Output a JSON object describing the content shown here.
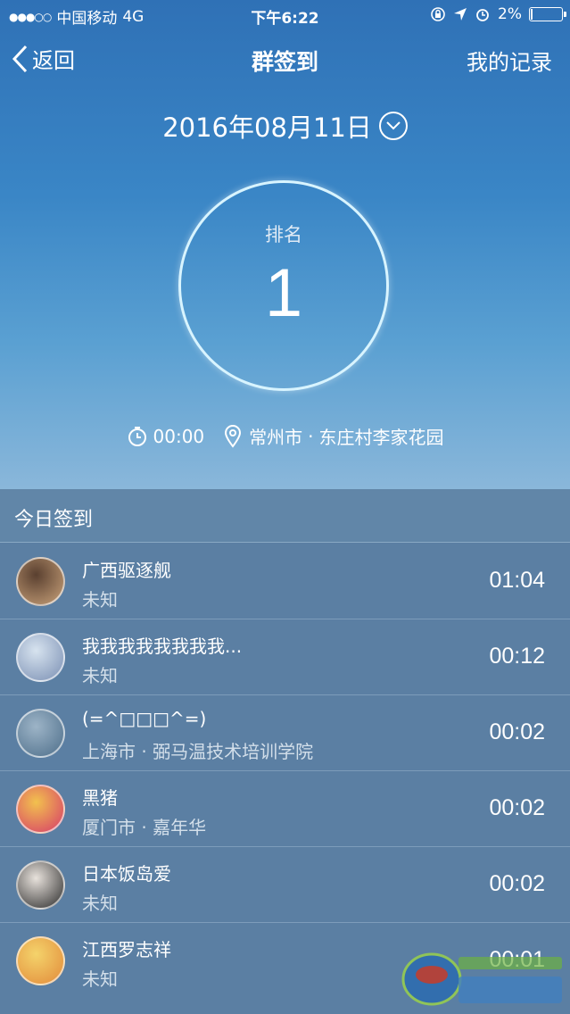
{
  "statusbar": {
    "carrier": "中国移动",
    "network": "4G",
    "time": "下午6:22",
    "battery_percent": "2%",
    "battery_level": 0.02
  },
  "nav": {
    "back_label": "返回",
    "title": "群签到",
    "right_label": "我的记录"
  },
  "date": "2016年08月11日",
  "rank": {
    "label": "排名",
    "value": "1"
  },
  "checkin": {
    "time": "00:00",
    "city": "常州市",
    "place": "东庄村李家花园",
    "separator": "·"
  },
  "list": {
    "header": "今日签到",
    "rows": [
      {
        "name": "广西驱逐舰",
        "place": "未知",
        "time": "01:04",
        "avatar_colors": [
          "#5a4030",
          "#c9a27a"
        ]
      },
      {
        "name": "我我我我我我我我...",
        "place": "未知",
        "time": "00:12",
        "avatar_colors": [
          "#d7e3ef",
          "#7a8fb3"
        ]
      },
      {
        "name": "(=^□□□^=)",
        "place": "上海市 · 弼马温技术培训学院",
        "time": "00:02",
        "avatar_colors": [
          "#9db4c7",
          "#4d6e8a"
        ]
      },
      {
        "name": "黑猪",
        "place": "厦门市 · 嘉年华",
        "time": "00:02",
        "avatar_colors": [
          "#f2c14e",
          "#d63a6a"
        ]
      },
      {
        "name": "日本饭岛爱",
        "place": "未知",
        "time": "00:02",
        "avatar_colors": [
          "#e8e2dc",
          "#2a2a2a"
        ]
      },
      {
        "name": "江西罗志祥",
        "place": "未知",
        "time": "00:01",
        "avatar_colors": [
          "#f4d36b",
          "#e28a3a"
        ]
      }
    ]
  }
}
